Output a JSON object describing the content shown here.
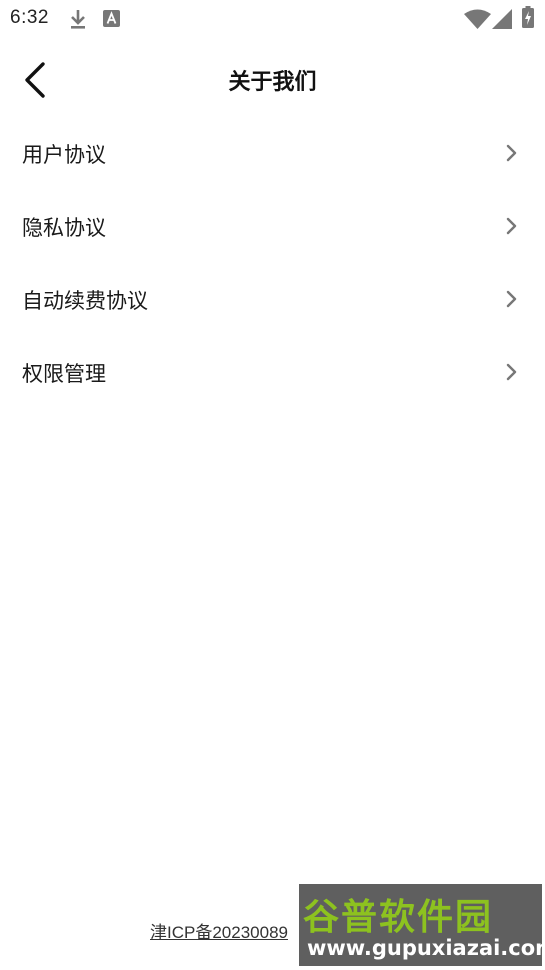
{
  "status_bar": {
    "time": "6:32",
    "icons": [
      "download-icon",
      "text-a-icon",
      "wifi-icon",
      "signal-icon",
      "battery-charging-icon"
    ]
  },
  "header": {
    "title": "关于我们",
    "back_icon": "chevron-left-icon"
  },
  "menu": {
    "items": [
      {
        "label": "用户协议",
        "icon": "chevron-right-icon"
      },
      {
        "label": "隐私协议",
        "icon": "chevron-right-icon"
      },
      {
        "label": "自动续费协议",
        "icon": "chevron-right-icon"
      },
      {
        "label": "权限管理",
        "icon": "chevron-right-icon"
      }
    ]
  },
  "footer": {
    "icp_text": "津ICP备20230089"
  },
  "watermark": {
    "brand": "谷普软件园",
    "url": "www.gupuxiazai.com"
  },
  "colors": {
    "background": "#ffffff",
    "text": "#111111",
    "chevron": "#777777",
    "watermark_green": "#8dc21f"
  }
}
